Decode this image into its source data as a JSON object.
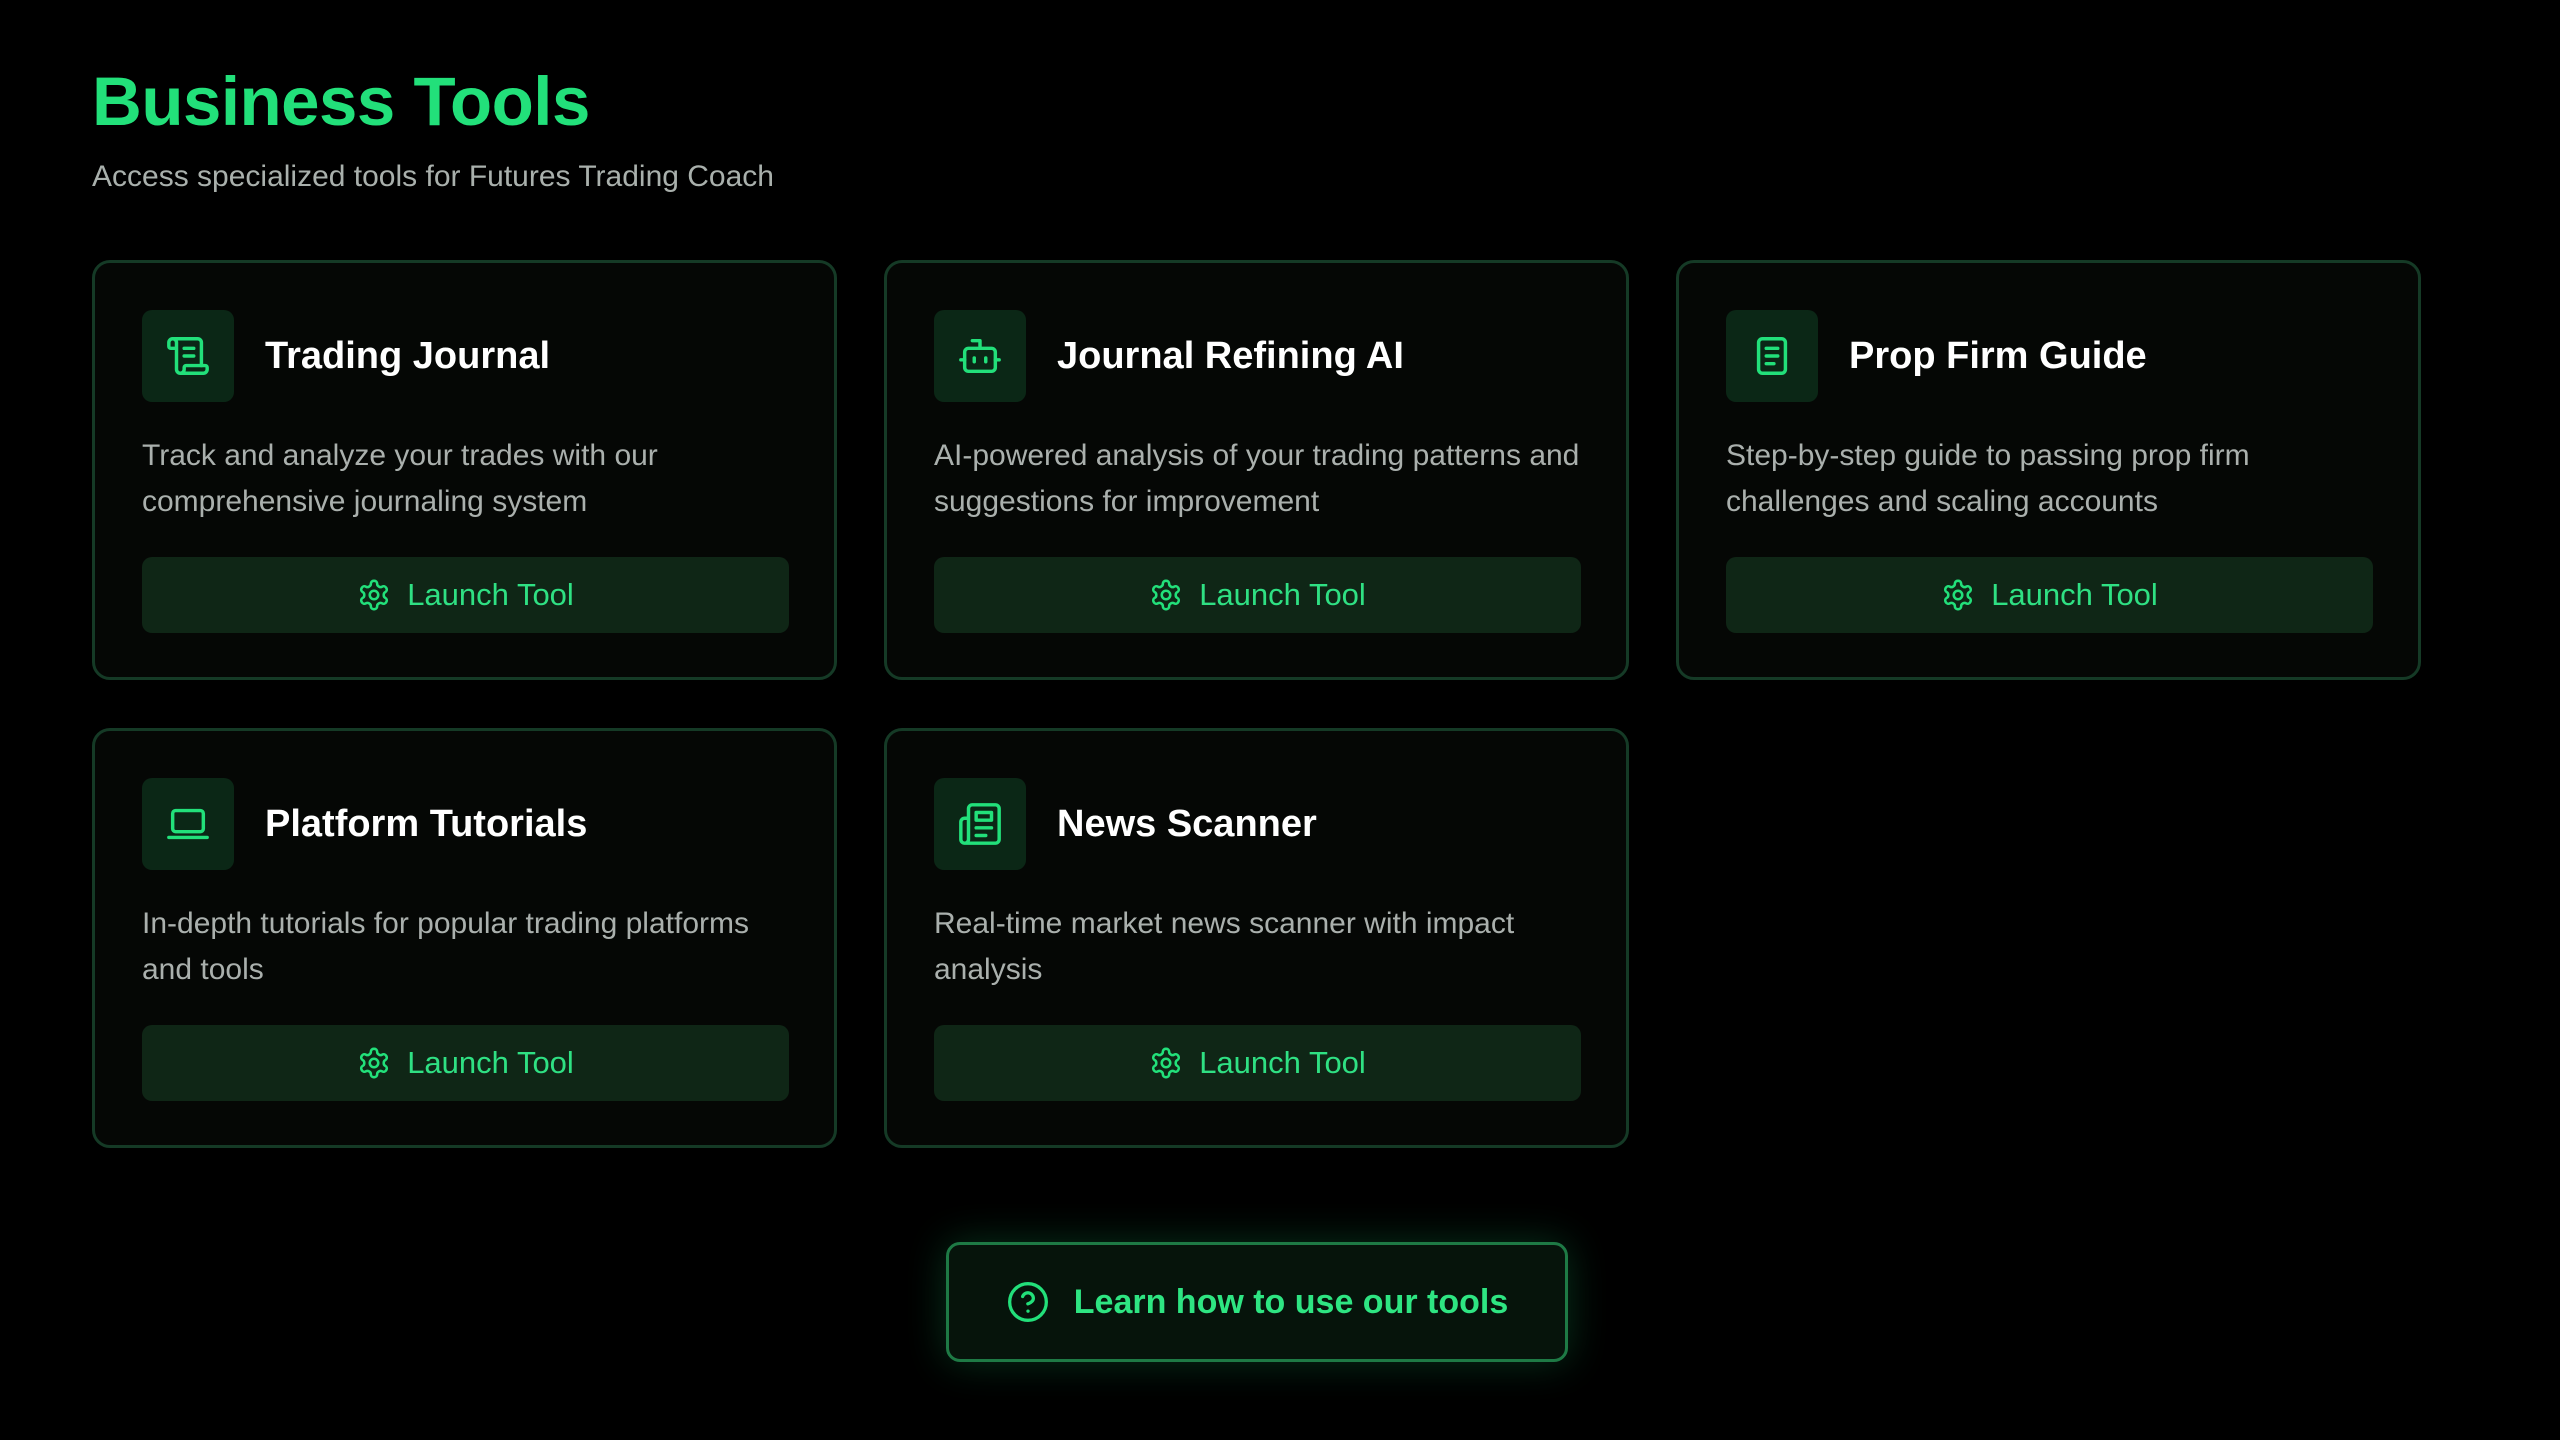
{
  "header": {
    "title": "Business Tools",
    "subtitle": "Access specialized tools for Futures Trading Coach"
  },
  "tools": [
    {
      "title": "Trading Journal",
      "description": "Track and analyze your trades with our comprehensive journaling system",
      "icon": "scroll-icon",
      "button_label": "Launch Tool"
    },
    {
      "title": "Journal Refining AI",
      "description": "AI-powered analysis of your trading patterns and suggestions for improvement",
      "icon": "bot-icon",
      "button_label": "Launch Tool"
    },
    {
      "title": "Prop Firm Guide",
      "description": "Step-by-step guide to passing prop firm challenges and scaling accounts",
      "icon": "book-icon",
      "button_label": "Launch Tool"
    },
    {
      "title": "Platform Tutorials",
      "description": "In-depth tutorials for popular trading platforms and tools",
      "icon": "laptop-icon",
      "button_label": "Launch Tool"
    },
    {
      "title": "News Scanner",
      "description": "Real-time market news scanner with impact analysis",
      "icon": "newspaper-icon",
      "button_label": "Launch Tool"
    }
  ],
  "footer": {
    "learn_label": "Learn how to use our tools",
    "learn_icon": "help-circle-icon"
  },
  "colors": {
    "background": "#000000",
    "accent": "#22e07a",
    "card_border": "#153a26",
    "button_bg": "#0f2616"
  }
}
